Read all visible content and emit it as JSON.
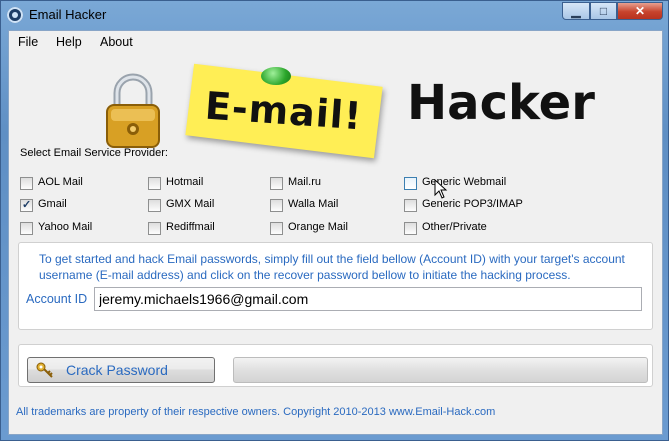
{
  "window": {
    "title": "Email Hacker"
  },
  "menu": [
    "File",
    "Help",
    "About"
  ],
  "banner": {
    "sticky_text": "E-mail!",
    "heading": "Hacker"
  },
  "providers": {
    "label": "Select Email Service Provider:",
    "items": [
      {
        "label": "AOL Mail",
        "checked": false
      },
      {
        "label": "Hotmail",
        "checked": false
      },
      {
        "label": "Mail.ru",
        "checked": false
      },
      {
        "label": "Generic Webmail",
        "checked": false
      },
      {
        "label": "Gmail",
        "checked": true
      },
      {
        "label": "GMX Mail",
        "checked": false
      },
      {
        "label": "Walla Mail",
        "checked": false
      },
      {
        "label": "Generic POP3/IMAP",
        "checked": false
      },
      {
        "label": "Yahoo Mail",
        "checked": false
      },
      {
        "label": "Rediffmail",
        "checked": false
      },
      {
        "label": "Orange Mail",
        "checked": false
      },
      {
        "label": "Other/Private",
        "checked": false
      }
    ]
  },
  "instructions": "To get started and hack Email passwords, simply fill out the field bellow (Account ID) with your target's account username (E-mail address) and click on the recover password bellow to initiate the hacking process.",
  "account": {
    "label": "Account ID",
    "value": "jeremy.michaels1966@gmail.com"
  },
  "action": {
    "button_label": "Crack Password",
    "progress": 0
  },
  "footer": "All trademarks are property of their respective owners. Copyright 2010-2013  www.Email-Hack.com",
  "colors": {
    "accent_text": "#2a6ac0",
    "sticky": "#ffee55"
  }
}
